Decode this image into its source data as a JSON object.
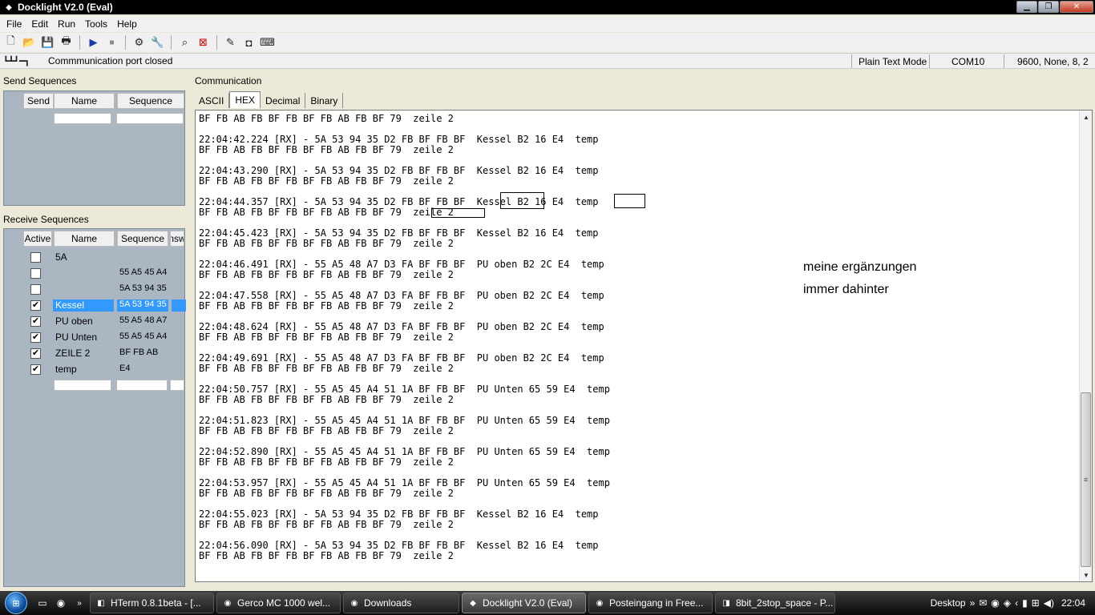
{
  "window": {
    "title": "Docklight V2.0 (Eval)",
    "min": "▁",
    "max": "❐",
    "close": "✕"
  },
  "menu": [
    "File",
    "Edit",
    "Run",
    "Tools",
    "Help"
  ],
  "status": {
    "port_text": "Commmunication port closed",
    "mode": "Plain Text Mode",
    "com": "COM10",
    "settings": "9600, None, 8, 2"
  },
  "send": {
    "label": "Send Sequences",
    "headers": {
      "send": "Send",
      "name": "Name",
      "sequence": "Sequence"
    }
  },
  "receive": {
    "label": "Receive Sequences",
    "headers": {
      "active": "Active",
      "name": "Name",
      "sequence": "Sequence",
      "answer": "nsw"
    },
    "rows": [
      {
        "checked": false,
        "name": "5A",
        "seq": ""
      },
      {
        "checked": false,
        "name": "",
        "seq": "55 A5 45 A4"
      },
      {
        "checked": false,
        "name": "",
        "seq": "5A 53 94 35"
      },
      {
        "checked": true,
        "name": "Kessel",
        "seq": "5A 53 94 35",
        "selected": true
      },
      {
        "checked": true,
        "name": "PU oben",
        "seq": "55 A5 48 A7"
      },
      {
        "checked": true,
        "name": "PU Unten",
        "seq": "55 A5 45 A4"
      },
      {
        "checked": true,
        "name": "ZEILE 2",
        "seq": "BF FB AB"
      },
      {
        "checked": true,
        "name": "temp",
        "seq": "E4"
      }
    ]
  },
  "comm": {
    "label": "Communication",
    "tabs": [
      "ASCII",
      "HEX",
      "Decimal",
      "Binary"
    ],
    "active_tab": "HEX",
    "annotation_line1": "meine ergänzungen",
    "annotation_line2": "immer dahinter",
    "log": [
      "BF FB AB FB BF FB BF FB AB FB BF 79  zeile 2",
      "",
      "22:04:42.224 [RX] - 5A 53 94 35 D2 FB BF FB BF  Kessel B2 16 E4  temp",
      "BF FB AB FB BF FB BF FB AB FB BF 79  zeile 2",
      "",
      "22:04:43.290 [RX] - 5A 53 94 35 D2 FB BF FB BF  Kessel B2 16 E4  temp",
      "BF FB AB FB BF FB BF FB AB FB BF 79  zeile 2",
      "",
      "22:04:44.357 [RX] - 5A 53 94 35 D2 FB BF FB BF  Kessel B2 16 E4  temp",
      "BF FB AB FB BF FB BF FB AB FB BF 79  zeile 2",
      "",
      "22:04:45.423 [RX] - 5A 53 94 35 D2 FB BF FB BF  Kessel B2 16 E4  temp",
      "BF FB AB FB BF FB BF FB AB FB BF 79  zeile 2",
      "",
      "22:04:46.491 [RX] - 55 A5 48 A7 D3 FA BF FB BF  PU oben B2 2C E4  temp",
      "BF FB AB FB BF FB BF FB AB FB BF 79  zeile 2",
      "",
      "22:04:47.558 [RX] - 55 A5 48 A7 D3 FA BF FB BF  PU oben B2 2C E4  temp",
      "BF FB AB FB BF FB BF FB AB FB BF 79  zeile 2",
      "",
      "22:04:48.624 [RX] - 55 A5 48 A7 D3 FA BF FB BF  PU oben B2 2C E4  temp",
      "BF FB AB FB BF FB BF FB AB FB BF 79  zeile 2",
      "",
      "22:04:49.691 [RX] - 55 A5 48 A7 D3 FA BF FB BF  PU oben B2 2C E4  temp",
      "BF FB AB FB BF FB BF FB AB FB BF 79  zeile 2",
      "",
      "22:04:50.757 [RX] - 55 A5 45 A4 51 1A BF FB BF  PU Unten 65 59 E4  temp",
      "BF FB AB FB BF FB BF FB AB FB BF 79  zeile 2",
      "",
      "22:04:51.823 [RX] - 55 A5 45 A4 51 1A BF FB BF  PU Unten 65 59 E4  temp",
      "BF FB AB FB BF FB BF FB AB FB BF 79  zeile 2",
      "",
      "22:04:52.890 [RX] - 55 A5 45 A4 51 1A BF FB BF  PU Unten 65 59 E4  temp",
      "BF FB AB FB BF FB BF FB AB FB BF 79  zeile 2",
      "",
      "22:04:53.957 [RX] - 55 A5 45 A4 51 1A BF FB BF  PU Unten 65 59 E4  temp",
      "BF FB AB FB BF FB BF FB AB FB BF 79  zeile 2",
      "",
      "22:04:55.023 [RX] - 5A 53 94 35 D2 FB BF FB BF  Kessel B2 16 E4  temp",
      "BF FB AB FB BF FB BF FB AB FB BF 79  zeile 2",
      "",
      "22:04:56.090 [RX] - 5A 53 94 35 D2 FB BF FB BF  Kessel B2 16 E4  temp",
      "BF FB AB FB BF FB BF FB AB FB BF 79  zeile 2"
    ]
  },
  "taskbar": {
    "start": "⊞",
    "items": [
      {
        "label": "HTerm 0.8.1beta - [...",
        "active": false
      },
      {
        "label": "Gerco MC 1000 wel...",
        "active": false
      },
      {
        "label": "Downloads",
        "active": false
      },
      {
        "label": "Docklight V2.0 (Eval)",
        "active": true
      },
      {
        "label": "Posteingang in Free...",
        "active": false
      },
      {
        "label": "8bit_2stop_space - P...",
        "active": false
      }
    ],
    "desktop": "Desktop",
    "clock": "22:04"
  },
  "colors": {
    "selection": "#3399ff",
    "titlebar": "#000000",
    "grid_bg": "#aab6c2"
  }
}
